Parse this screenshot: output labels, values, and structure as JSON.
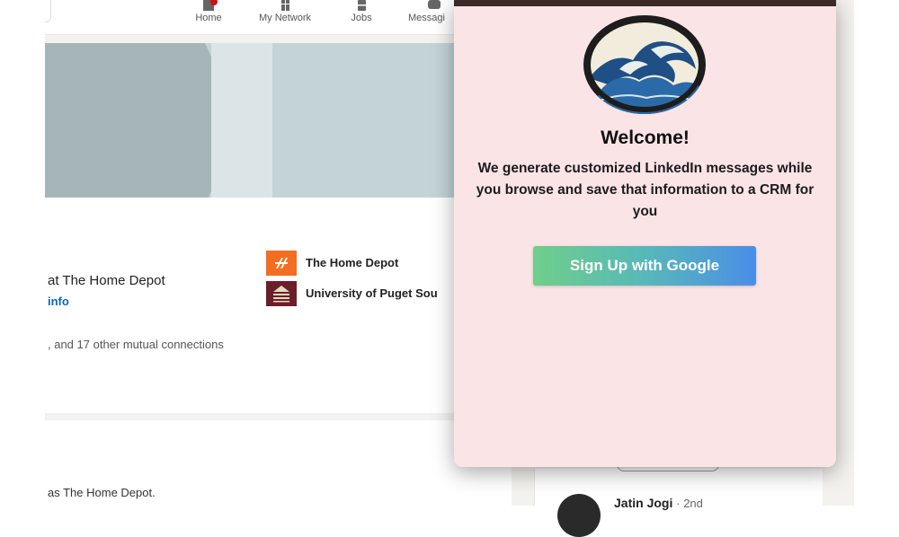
{
  "nav": {
    "items": [
      {
        "label": "Home"
      },
      {
        "label": "My Network"
      },
      {
        "label": "Jobs"
      },
      {
        "label": "Messagi"
      }
    ]
  },
  "profile": {
    "headline": "at The Home Depot",
    "contact_link": "info",
    "mutual_connections": ", and 17 other mutual connections",
    "organizations": [
      {
        "name": "The Home Depot"
      },
      {
        "name": "University of Puget Sou"
      }
    ]
  },
  "about": {
    "text": "as The Home Depot."
  },
  "people_also_viewed": {
    "name": "Jatin Jogi",
    "degree": "· 2nd"
  },
  "popup": {
    "title": "Welcome!",
    "description": "We generate customized LinkedIn messages while you browse and save that information to a CRM for you",
    "signup_label": "Sign Up with Google"
  },
  "colors": {
    "popup_background": "#fbe4e6",
    "link_blue": "#0a66c2",
    "button_gradient_start": "#6fcf8a",
    "button_gradient_end": "#4a8ee8"
  }
}
